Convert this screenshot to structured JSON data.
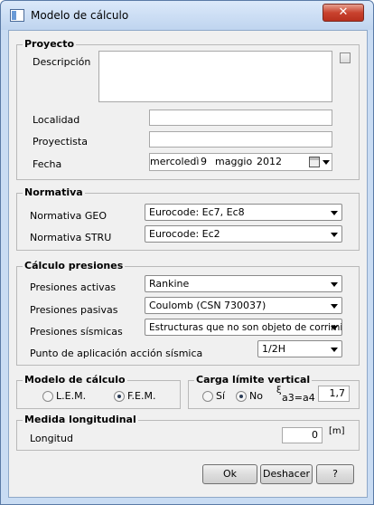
{
  "window": {
    "title": "Modelo de cálculo",
    "close_glyph": "✕"
  },
  "proyecto": {
    "legend": "Proyecto",
    "descripcion_label": "Descripción",
    "descripcion_value": "",
    "localidad_label": "Localidad",
    "localidad_value": "",
    "proyectista_label": "Proyectista",
    "proyectista_value": "",
    "fecha_label": "Fecha",
    "fecha_weekday": "mercoledì",
    "fecha_day": "9",
    "fecha_month": "maggio",
    "fecha_year": "2012"
  },
  "normativa": {
    "legend": "Normativa",
    "geo_label": "Normativa GEO",
    "geo_value": "Eurocode: Ec7, Ec8",
    "stru_label": "Normativa STRU",
    "stru_value": "Eurocode: Ec2"
  },
  "calculo": {
    "legend": "Cálculo presiones",
    "activas_label": "Presiones activas",
    "activas_value": "Rankine",
    "pasivas_label": "Presiones pasivas",
    "pasivas_value": "Coulomb (CSN 730037)",
    "sismicas_label": "Presiones sísmicas",
    "sismicas_value": "Estructuras que no  son objeto de corrimi",
    "punto_label": "Punto de aplicación acción sísmica",
    "punto_value": "1/2H"
  },
  "modelo": {
    "legend": "Modelo de cálculo",
    "lem_label": "L.E.M.",
    "fem_label": "F.E.M.",
    "selected": "F.E.M."
  },
  "carga": {
    "legend": "Carga límite vertical",
    "si_label": "Sí",
    "no_label": "No",
    "selected": "No",
    "xi_symbol": "ξ",
    "xi_sub": "a3=a4",
    "value": "1,7"
  },
  "medida": {
    "legend": "Medida longitudinal",
    "longitud_label": "Longitud",
    "longitud_value": "0",
    "unit": "[m]"
  },
  "buttons": {
    "ok": "Ok",
    "deshacer": "Deshacer",
    "help": "?"
  }
}
